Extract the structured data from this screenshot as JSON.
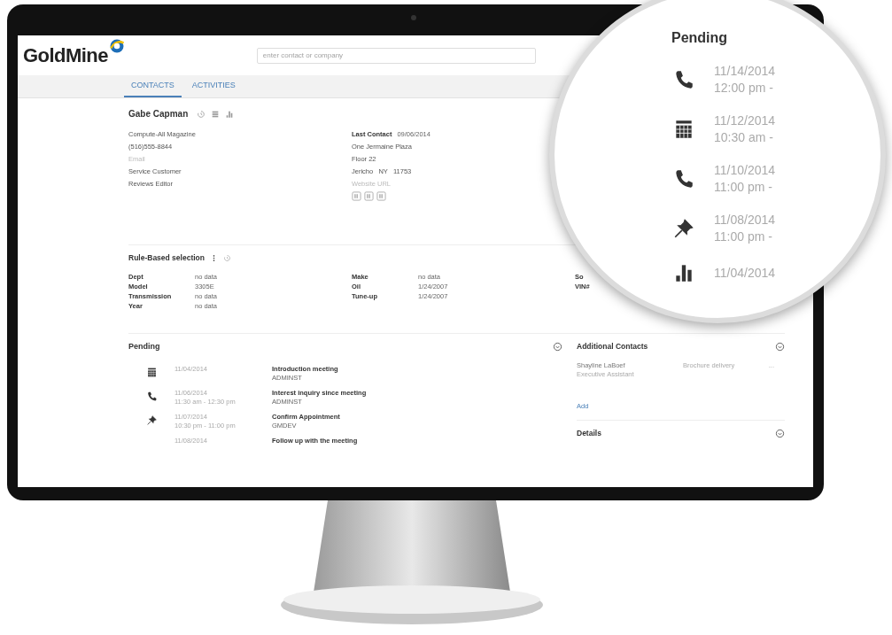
{
  "app": {
    "logo": "GoldMine",
    "search": {
      "placeholder": "enter contact or company"
    }
  },
  "tabs": [
    {
      "label": "CONTACTS",
      "selected": true
    },
    {
      "label": "ACTIVITIES",
      "selected": false
    }
  ],
  "contact": {
    "name": "Gabe Capman",
    "details": [
      {
        "text": "Compute-All Magazine",
        "kind": "value"
      },
      {
        "text": "(516)555-8844",
        "kind": "value"
      },
      {
        "text": "Email",
        "kind": "placeholder"
      },
      {
        "text": "Service Customer",
        "kind": "value"
      },
      {
        "text": "Reviews Editor",
        "kind": "value"
      }
    ],
    "last_contact": {
      "label": "Last Contact",
      "value": "09/06/2014"
    },
    "address": [
      {
        "text": "One Jermaine Plaza",
        "kind": "value"
      },
      {
        "text": "Floor 22",
        "kind": "value"
      },
      {
        "text": "Jericho   NY   11753",
        "kind": "value"
      },
      {
        "text": "Website URL",
        "kind": "placeholder"
      }
    ]
  },
  "rule_based": {
    "title": "Rule-Based selection",
    "columns": [
      [
        {
          "label": "Dept",
          "value": "no data"
        },
        {
          "label": "Model",
          "value": "3305E"
        },
        {
          "label": "Transmission",
          "value": "no data"
        },
        {
          "label": "Year",
          "value": "no data"
        }
      ],
      [
        {
          "label": "Make",
          "value": "no data"
        },
        {
          "label": "Oil",
          "value": "1/24/2007"
        },
        {
          "label": "Tune-up",
          "value": "1/24/2007"
        }
      ],
      [
        {
          "label": "So"
        },
        {
          "label": "VIN#"
        }
      ]
    ]
  },
  "pending": {
    "title": "Pending",
    "items": [
      {
        "kind": "calendar",
        "date": "11/04/2014",
        "title": "Introduction meeting",
        "owner": "ADMINST"
      },
      {
        "kind": "phone",
        "date": "11/06/2014",
        "time": "11:30 am - 12:30 pm",
        "title": "Interest inquiry since meeting",
        "owner": "ADMINST"
      },
      {
        "kind": "pin",
        "date": "11/07/2014",
        "time": "10:30 pm - 11:00 pm",
        "title": "Confirm Appointment",
        "owner": "GMDEV"
      },
      {
        "kind": "unknown",
        "date": "11/08/2014",
        "title": "Follow up with the meeting"
      }
    ]
  },
  "additional_contacts": {
    "title": "Additional Contacts",
    "contacts": [
      {
        "name": "Shayline LaBoef",
        "role": "Executive Assistant",
        "note": "Brochure delivery",
        "more": "..."
      }
    ],
    "add_link": "Add"
  },
  "details": {
    "title": "Details"
  },
  "magnifier": {
    "title": "Pending",
    "items": [
      {
        "kind": "phone",
        "date": "11/14/2014",
        "time": "12:00 pm -"
      },
      {
        "kind": "calendar",
        "date": "11/12/2014",
        "time": "10:30 am -"
      },
      {
        "kind": "phone",
        "date": "11/10/2014",
        "time": "11:00 pm -"
      },
      {
        "kind": "pin",
        "date": "11/08/2014",
        "time": "11:00 pm -"
      },
      {
        "kind": "chart",
        "date": "11/04/2014"
      }
    ]
  }
}
